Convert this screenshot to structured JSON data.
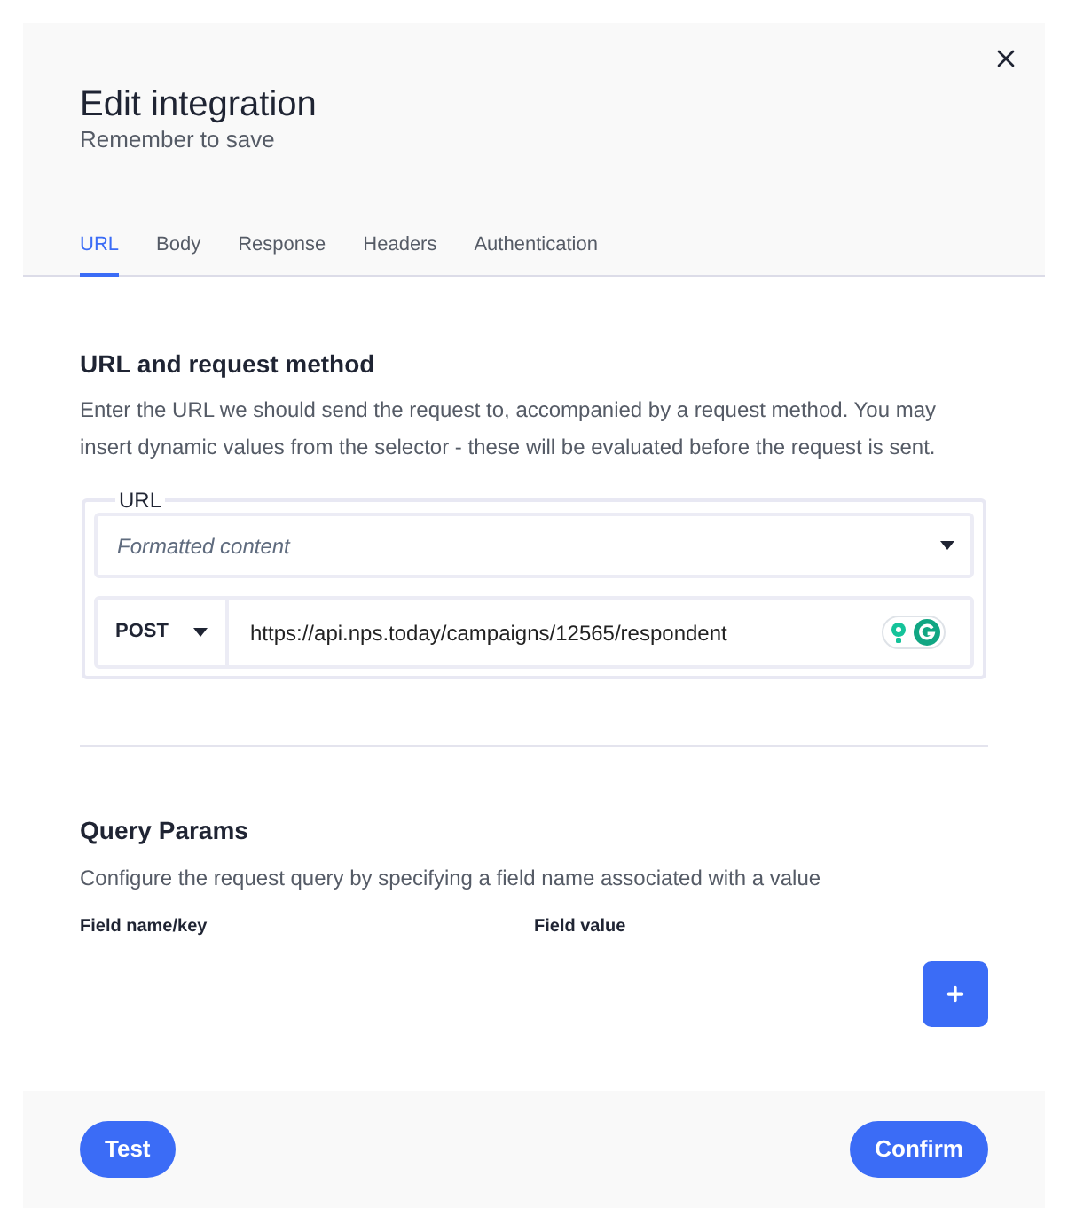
{
  "dialog": {
    "title": "Edit integration",
    "subtitle": "Remember to save"
  },
  "tabs": [
    {
      "label": "URL",
      "selected": true
    },
    {
      "label": "Body",
      "selected": false
    },
    {
      "label": "Response",
      "selected": false
    },
    {
      "label": "Headers",
      "selected": false
    },
    {
      "label": "Authentication",
      "selected": false
    }
  ],
  "url_section": {
    "heading": "URL and request method",
    "description": "Enter the URL we should send the request to, accompanied by a request method. You may insert dynamic values from the selector - these will be evaluated before the request is sent.",
    "url_group": {
      "legend": "URL",
      "content_select": {
        "placeholder": "Formatted content"
      },
      "method_select": {
        "value": "POST"
      },
      "url_input": {
        "value": "https://api.nps.today/campaigns/12565/respondent"
      }
    }
  },
  "query_params": {
    "heading": "Query Params",
    "description": "Configure the request query by specifying a field name associated with a value",
    "columns": [
      "Field name/key",
      "Field value"
    ]
  },
  "footer": {
    "buttons": [
      {
        "label": "Test"
      },
      {
        "label": "Confirm"
      }
    ]
  }
}
